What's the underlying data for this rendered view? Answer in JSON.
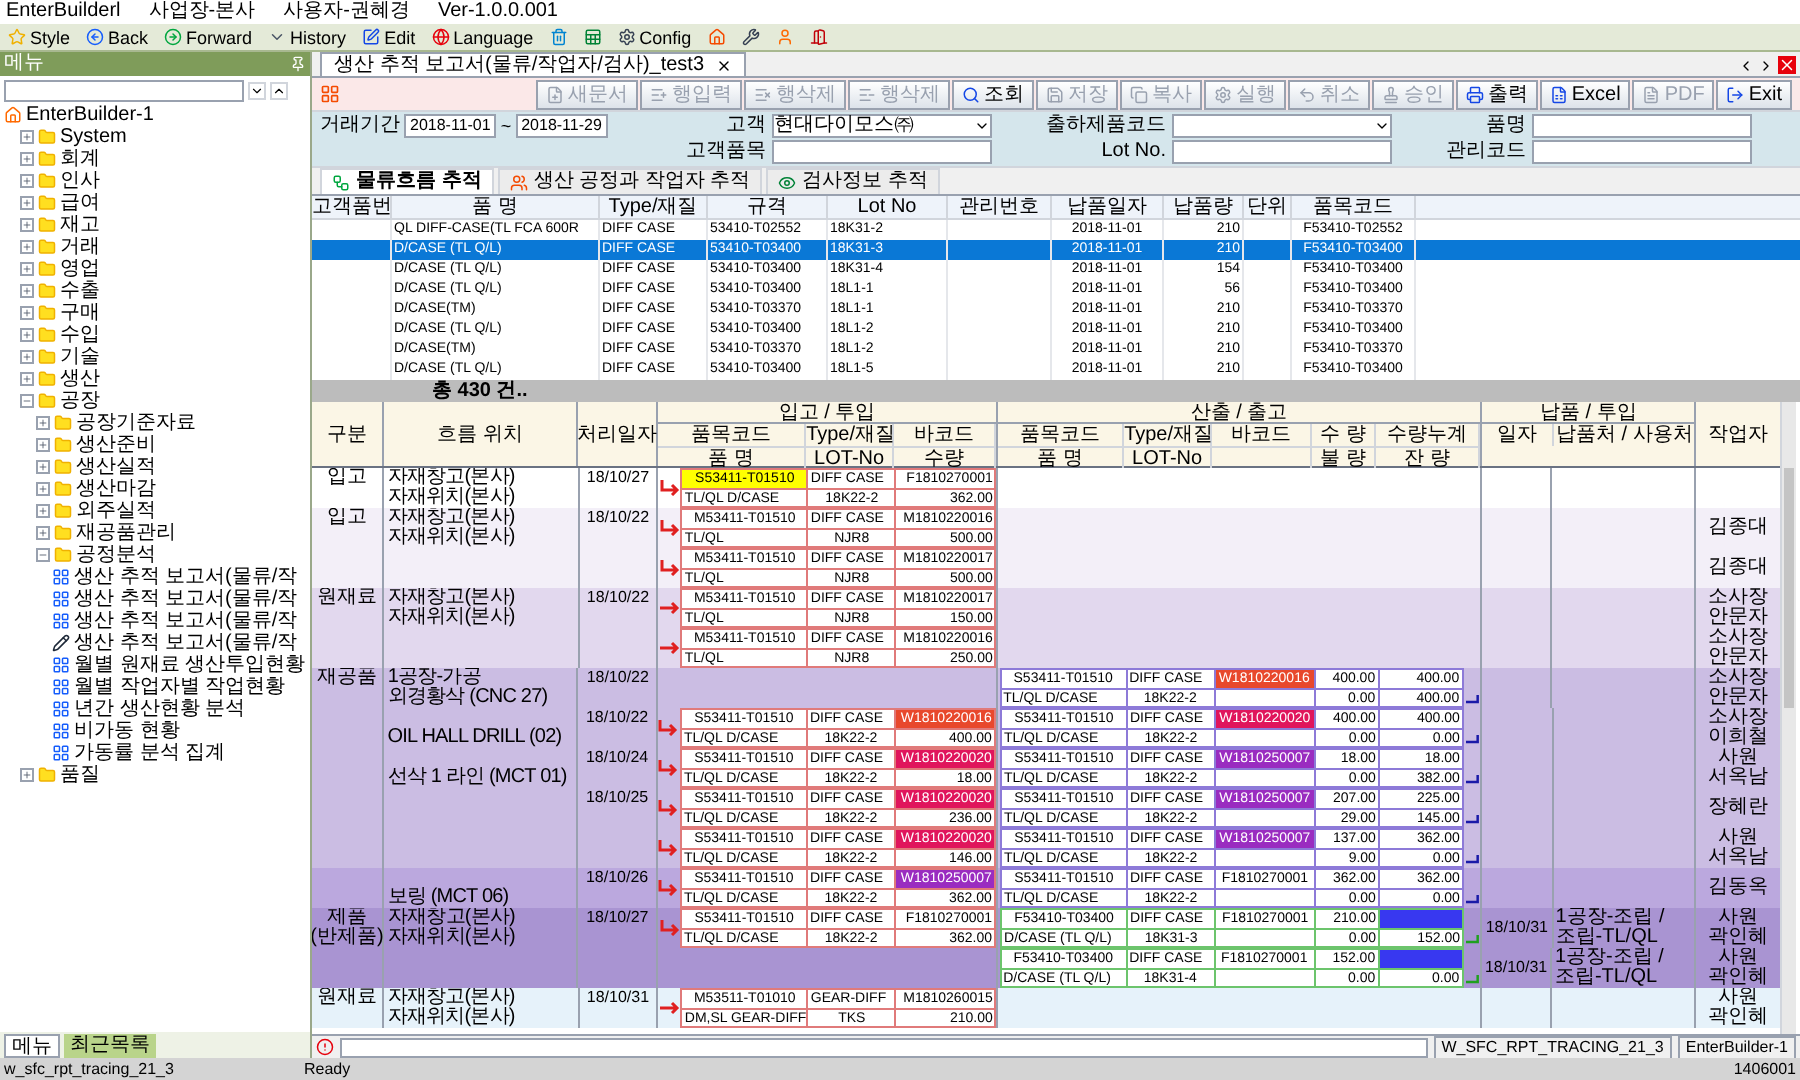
{
  "app_title": {
    "app": "EnterBuilderl",
    "site": "사업장-본사",
    "user": "사용자-권혜경",
    "version": "Ver-1.0.0.001"
  },
  "toolbar": [
    {
      "kind": "star",
      "label": "Style"
    },
    {
      "kind": "back",
      "label": "Back"
    },
    {
      "kind": "forward",
      "label": "Forward"
    },
    {
      "kind": "history",
      "label": "History"
    },
    {
      "kind": "edit",
      "label": "Edit"
    },
    {
      "kind": "language",
      "label": "Language"
    },
    {
      "kind": "bin"
    },
    {
      "kind": "sheet"
    },
    {
      "kind": "config",
      "label": "Config"
    },
    {
      "kind": "home"
    },
    {
      "kind": "tools"
    },
    {
      "kind": "user"
    },
    {
      "kind": "exit"
    }
  ],
  "sidebar": {
    "title": "메뉴",
    "tree": [
      {
        "label": "EnterBuilder-1",
        "kind": "root",
        "children": [
          {
            "label": "System",
            "kind": "folder",
            "expanded": false
          },
          {
            "label": "회계",
            "kind": "folder",
            "expanded": false
          },
          {
            "label": "인사",
            "kind": "folder",
            "expanded": false
          },
          {
            "label": "급여",
            "kind": "folder",
            "expanded": false
          },
          {
            "label": "재고",
            "kind": "folder",
            "expanded": false
          },
          {
            "label": "거래",
            "kind": "folder",
            "expanded": false
          },
          {
            "label": "영업",
            "kind": "folder",
            "expanded": false
          },
          {
            "label": "수출",
            "kind": "folder",
            "expanded": false
          },
          {
            "label": "구매",
            "kind": "folder",
            "expanded": false
          },
          {
            "label": "수입",
            "kind": "folder",
            "expanded": false
          },
          {
            "label": "기술",
            "kind": "folder",
            "expanded": false
          },
          {
            "label": "생산",
            "kind": "folder",
            "expanded": false
          },
          {
            "label": "공장",
            "kind": "folder",
            "expanded": true,
            "children": [
              {
                "label": "공장기준자료",
                "kind": "folder",
                "expanded": false
              },
              {
                "label": "생산준비",
                "kind": "folder",
                "expanded": false
              },
              {
                "label": "생산실적",
                "kind": "folder",
                "expanded": false
              },
              {
                "label": "생산마감",
                "kind": "folder",
                "expanded": false
              },
              {
                "label": "외주실적",
                "kind": "folder",
                "expanded": false
              },
              {
                "label": "재공품관리",
                "kind": "folder",
                "expanded": false
              },
              {
                "label": "공정분석",
                "kind": "folder",
                "expanded": true,
                "children": [
                  {
                    "label": "생산 추적 보고서(물류/작",
                    "kind": "program"
                  },
                  {
                    "label": "생산 추적 보고서(물류/작",
                    "kind": "program"
                  },
                  {
                    "label": "생산 추적 보고서(물류/작",
                    "kind": "program"
                  },
                  {
                    "label": "생산 추적 보고서(물류/작",
                    "kind": "active_program"
                  },
                  {
                    "label": "월별 원재료 생산투입현황",
                    "kind": "program"
                  },
                  {
                    "label": "월별 작업자별 작업현황",
                    "kind": "program"
                  },
                  {
                    "label": "년간 생산현황 분석",
                    "kind": "program"
                  },
                  {
                    "label": "비가동 현황",
                    "kind": "program"
                  },
                  {
                    "label": "가동률 분석 집계",
                    "kind": "program"
                  }
                ]
              }
            ]
          },
          {
            "label": "품질",
            "kind": "folder",
            "expanded": false
          }
        ]
      }
    ],
    "bottom_tabs": [
      {
        "label": "메뉴",
        "selected": true
      },
      {
        "label": "최근목록",
        "selected": false
      }
    ]
  },
  "doc_tab": {
    "title": "생산 추적 보고서(물류/작업자/검사)_test3",
    "selected": true
  },
  "actions": [
    {
      "kind": "new",
      "label": "새문서",
      "disabled": true
    },
    {
      "kind": "row_add",
      "label": "행입력",
      "disabled": true
    },
    {
      "kind": "row_del",
      "label": "행삭제",
      "disabled": true
    },
    {
      "kind": "row_del2",
      "label": "행삭제",
      "disabled": true
    },
    {
      "kind": "search",
      "label": "조회",
      "disabled": false
    },
    {
      "kind": "save",
      "label": "저장",
      "disabled": true
    },
    {
      "kind": "copy",
      "label": "복사",
      "disabled": true
    },
    {
      "kind": "run",
      "label": "실행",
      "disabled": true
    },
    {
      "kind": "cancel",
      "label": "취소",
      "disabled": true
    },
    {
      "kind": "approve",
      "label": "승인",
      "disabled": true
    },
    {
      "kind": "print",
      "label": "출력",
      "disabled": false
    },
    {
      "kind": "excel",
      "label": "Excel",
      "disabled": false
    },
    {
      "kind": "pdf",
      "label": "PDF",
      "disabled": true
    },
    {
      "kind": "exit",
      "label": "Exit",
      "disabled": false
    }
  ],
  "filters": {
    "period": {
      "label": "거래기간",
      "from": "2018-11-01",
      "separator": "~",
      "to": "2018-11-29"
    },
    "fields": [
      {
        "kind": "combo",
        "label": "고객",
        "value": "현대다이모스㈜"
      },
      {
        "kind": "combo",
        "label": "출하제품코드"
      },
      {
        "kind": "text",
        "label": "품명"
      },
      {
        "kind": "text",
        "label": "고객품목"
      },
      {
        "kind": "text",
        "label": "Lot No."
      },
      {
        "kind": "text",
        "label": "관리코드"
      }
    ]
  },
  "view_tabs": [
    {
      "kind": "flow",
      "label": "물류흐름 추적",
      "selected": true
    },
    {
      "kind": "worker",
      "label": "생산 공정과 작업자 추적",
      "selected": false
    },
    {
      "kind": "inspect",
      "label": "검사정보 추적",
      "selected": false
    }
  ],
  "summary_grid": {
    "columns": [
      "고객품번",
      "품 명",
      "Type/재질",
      "규격",
      "Lot No",
      "관리번호",
      "납품일자",
      "납품량",
      "단위",
      "품목코드"
    ],
    "rows": [
      {
        "name": "QL DIFF-CASE(TL FCA 600R",
        "type": "DIFF CASE",
        "spec": "53410-T02552",
        "lot": "18K31-2",
        "date": "2018-11-01",
        "qty": "210",
        "code": "F53410-T02552",
        "selected": false
      },
      {
        "name": "D/CASE (TL Q/L)",
        "type": "DIFF CASE",
        "spec": "53410-T03400",
        "lot": "18K31-3",
        "date": "2018-11-01",
        "qty": "210",
        "code": "F53410-T03400",
        "selected": true
      },
      {
        "name": "D/CASE (TL Q/L)",
        "type": "DIFF CASE",
        "spec": "53410-T03400",
        "lot": "18K31-4",
        "date": "2018-11-01",
        "qty": "154",
        "code": "F53410-T03400",
        "selected": false
      },
      {
        "name": "D/CASE (TL Q/L)",
        "type": "DIFF CASE",
        "spec": "53410-T03400",
        "lot": "18L1-1",
        "date": "2018-11-01",
        "qty": "56",
        "code": "F53410-T03400",
        "selected": false
      },
      {
        "name": "D/CASE(TM)",
        "type": "DIFF CASE",
        "spec": "53410-T03370",
        "lot": "18L1-1",
        "date": "2018-11-01",
        "qty": "210",
        "code": "F53410-T03370",
        "selected": false
      },
      {
        "name": "D/CASE (TL Q/L)",
        "type": "DIFF CASE",
        "spec": "53410-T03400",
        "lot": "18L1-2",
        "date": "2018-11-01",
        "qty": "210",
        "code": "F53410-T03400",
        "selected": false
      },
      {
        "name": "D/CASE(TM)",
        "type": "DIFF CASE",
        "spec": "53410-T03370",
        "lot": "18L1-2",
        "date": "2018-11-01",
        "qty": "210",
        "code": "F53410-T03370",
        "selected": false
      },
      {
        "name": "D/CASE (TL Q/L)",
        "type": "DIFF CASE",
        "spec": "53410-T03400",
        "lot": "18L1-5",
        "date": "2018-11-01",
        "qty": "210",
        "code": "F53410-T03400",
        "selected": false
      }
    ],
    "footer": "총 430 건.."
  },
  "trace_grid": {
    "headers": {
      "category": "구분",
      "location": "흐름 위치",
      "date": "처리일자",
      "in_group": "입고 / 투입",
      "out_group": "산출 / 출고",
      "delivery_group": "납품 / 투입",
      "worker": "작업자",
      "delivery_date": "일자",
      "delivery_place": "납품처 / 사용처",
      "in_columns": [
        [
          "품목코드",
          "품 명"
        ],
        [
          "Type/재질",
          "LOT-No"
        ],
        [
          "바코드",
          "수량"
        ]
      ],
      "out_columns": [
        [
          "품목코드",
          "품 명"
        ],
        [
          "Type/재질",
          "LOT-No"
        ],
        [
          "바코드"
        ],
        [
          "수 량",
          "불 량"
        ],
        [
          "수량누계",
          "잔 량"
        ]
      ]
    },
    "rows": [
      {
        "color": "#ffffff",
        "category": "입고",
        "location": [
          "자재창고(본사)",
          "자재위치(본사)"
        ],
        "date": "18/10/27",
        "in": {
          "kind": "return",
          "code": "S53411-T01510",
          "highlight": true,
          "type": "DIFF CASE",
          "barcode": {
            "text": "F1810270001"
          },
          "name": "TL/QL D/CASE",
          "lot": "18K22-2",
          "qty": "362.00"
        }
      },
      {
        "color": "#f3eff8",
        "category": "입고",
        "location": [
          "자재창고(본사)",
          "자재위치(본사)"
        ],
        "date": "18/10/22",
        "in": {
          "kind": "return",
          "code": "M53411-T01510",
          "highlight": false,
          "type": "DIFF CASE",
          "barcode": {
            "text": "M1810220016"
          },
          "name": "TL/QL",
          "lot": "NJR8",
          "qty": "500.00"
        },
        "worker": "김종대"
      },
      {
        "color": "#f3eff8",
        "in": {
          "kind": "return",
          "code": "M53411-T01510",
          "highlight": false,
          "type": "DIFF CASE",
          "barcode": {
            "text": "M1810220017"
          },
          "name": "TL/QL",
          "lot": "NJR8",
          "qty": "500.00"
        },
        "worker": "김종대"
      },
      {
        "color": "#e2d8ee",
        "category": "원재료",
        "location": [
          "자재창고(본사)",
          "자재위치(본사)"
        ],
        "date": "18/10/22",
        "in": {
          "kind": "straight",
          "code": "M53411-T01510",
          "highlight": false,
          "type": "DIFF CASE",
          "barcode": {
            "text": "M1810220017"
          },
          "name": "TL/QL",
          "lot": "NJR8",
          "qty": "150.00"
        },
        "worker": "소사장 안문자"
      },
      {
        "color": "#e2d8ee",
        "in": {
          "kind": "straight",
          "code": "M53411-T01510",
          "highlight": false,
          "type": "DIFF CASE",
          "barcode": {
            "text": "M1810220016"
          },
          "name": "TL/QL",
          "lot": "NJR8",
          "qty": "250.00"
        },
        "worker": "소사장 안문자"
      },
      {
        "color": "#cbbde3",
        "category": "재공품",
        "location": [
          "1공장-가공",
          "외경황삭 (CNC 27)"
        ],
        "date": "18/10/22",
        "out": {
          "kind": "wip",
          "code": "S53411-T01510",
          "type": "DIFF CASE",
          "barcode": {
            "text": "W1810220016",
            "color": "#e8482c"
          },
          "name": "TL/QL D/CASE",
          "lot": "18K22-2",
          "qty": "400.00",
          "defect": "0.00",
          "cum": "400.00",
          "remain": "400.00"
        },
        "worker": "소사장 안문자"
      },
      {
        "color": "#cbbde3",
        "location": [
          "OIL HALL DRILL (02)"
        ],
        "date": "18/10/22",
        "in": {
          "kind": "return",
          "code": "S53411-T01510",
          "highlight": false,
          "type": "DIFF CASE",
          "barcode": {
            "text": "W1810220016",
            "color": "#e8482c"
          },
          "name": "TL/QL D/CASE",
          "lot": "18K22-2",
          "qty": "400.00"
        },
        "out": {
          "kind": "wip",
          "code": "S53411-T01510",
          "type": "DIFF CASE",
          "barcode": {
            "text": "W1810220020",
            "color": "#e0155c"
          },
          "name": "TL/QL D/CASE",
          "lot": "18K22-2",
          "qty": "400.00",
          "defect": "0.00",
          "cum": "400.00",
          "remain": "0.00"
        },
        "worker": "소사장 이희철"
      },
      {
        "color": "#cbbde3",
        "location": [
          "선삭 1 라인 (MCT 01)"
        ],
        "date": "18/10/24",
        "in": {
          "kind": "return",
          "code": "S53411-T01510",
          "highlight": false,
          "type": "DIFF CASE",
          "barcode": {
            "text": "W1810220020",
            "color": "#e0155c"
          },
          "name": "TL/QL D/CASE",
          "lot": "18K22-2",
          "qty": "18.00"
        },
        "out": {
          "kind": "wip",
          "code": "S53411-T01510",
          "type": "DIFF CASE",
          "barcode": {
            "text": "W1810250007",
            "color": "#9a2cc0"
          },
          "name": "TL/QL D/CASE",
          "lot": "18K22-2",
          "qty": "18.00",
          "defect": "0.00",
          "cum": "18.00",
          "remain": "382.00"
        },
        "worker": "사원 서옥남"
      },
      {
        "color": "#cbbde3",
        "date": "18/10/25",
        "in": {
          "kind": "return",
          "code": "S53411-T01510",
          "highlight": false,
          "type": "DIFF CASE",
          "barcode": {
            "text": "W1810220020",
            "color": "#e0155c"
          },
          "name": "TL/QL D/CASE",
          "lot": "18K22-2",
          "qty": "236.00"
        },
        "out": {
          "kind": "wip",
          "code": "S53411-T01510",
          "type": "DIFF CASE",
          "barcode": {
            "text": "W1810250007",
            "color": "#9a2cc0"
          },
          "name": "TL/QL D/CASE",
          "lot": "18K22-2",
          "qty": "207.00",
          "defect": "29.00",
          "cum": "225.00",
          "remain": "145.00"
        },
        "worker": "장혜란"
      },
      {
        "color": "#cbbde3",
        "in": {
          "kind": "return",
          "code": "S53411-T01510",
          "highlight": false,
          "type": "DIFF CASE",
          "barcode": {
            "text": "W1810220020",
            "color": "#e0155c"
          },
          "name": "TL/QL D/CASE",
          "lot": "18K22-2",
          "qty": "146.00"
        },
        "out": {
          "kind": "wip",
          "code": "S53411-T01510",
          "type": "DIFF CASE",
          "barcode": {
            "text": "W1810250007",
            "color": "#9a2cc0"
          },
          "name": "TL/QL D/CASE",
          "lot": "18K22-2",
          "qty": "137.00",
          "defect": "9.00",
          "cum": "362.00",
          "remain": "0.00"
        },
        "worker": "사원 서옥남"
      },
      {
        "color": "#bba8de",
        "location": [
          "보링 (MCT 06)"
        ],
        "date": "18/10/26",
        "in": {
          "kind": "return",
          "code": "S53411-T01510",
          "highlight": false,
          "type": "DIFF CASE",
          "barcode": {
            "text": "W1810250007",
            "color": "#9a2cc0"
          },
          "name": "TL/QL D/CASE",
          "lot": "18K22-2",
          "qty": "362.00"
        },
        "out": {
          "kind": "wip",
          "code": "S53411-T01510",
          "type": "DIFF CASE",
          "barcode": {
            "text": "F1810270001"
          },
          "name": "TL/QL D/CASE",
          "lot": "18K22-2",
          "qty": "362.00",
          "defect": "0.00",
          "cum": "362.00",
          "remain": "0.00"
        },
        "worker": "김동옥"
      },
      {
        "color": "#a994d2",
        "category": "제품\n(반제품)",
        "location": [
          "자재창고(본사)",
          "자재위치(본사)"
        ],
        "date": "18/10/27",
        "in": {
          "kind": "return",
          "code": "S53411-T01510",
          "highlight": false,
          "type": "DIFF CASE",
          "barcode": {
            "text": "F1810270001"
          },
          "name": "TL/QL D/CASE",
          "lot": "18K22-2",
          "qty": "362.00"
        },
        "out": {
          "kind": "product",
          "code": "F53410-T03400",
          "type": "DIFF CASE",
          "barcode": {
            "text": "F1810270001"
          },
          "name": "D/CASE (TL Q/L)",
          "lot": "18K31-3",
          "qty": "210.00",
          "defect": "0.00",
          "cum_bar": true,
          "remain": "152.00"
        },
        "delivery": {
          "date": "18/10/31",
          "place": "1공장-조립 / 조립-TL/QL"
        },
        "worker": "사원 곽인혜"
      },
      {
        "color": "#a994d2",
        "out": {
          "kind": "product",
          "code": "F53410-T03400",
          "type": "DIFF CASE",
          "barcode": {
            "text": "F1810270001"
          },
          "name": "D/CASE (TL Q/L)",
          "lot": "18K31-4",
          "qty": "152.00",
          "defect": "0.00",
          "cum_bar": true,
          "remain": "0.00"
        },
        "delivery": {
          "date": "18/10/31",
          "place": "1공장-조립 / 조립-TL/QL"
        },
        "worker": "사원 곽인혜"
      },
      {
        "color": "#e6f2fa",
        "category": "원재료",
        "location": [
          "자재창고(본사)",
          "자재위치(본사)"
        ],
        "date": "18/10/31",
        "in": {
          "kind": "straight",
          "code": "M53511-T01010",
          "highlight": false,
          "type": "GEAR-DIFF",
          "barcode": {
            "text": "M1810260015"
          },
          "name": "DM,SL GEAR-DIFF",
          "lot": "TKS",
          "qty": "210.00"
        },
        "worker": "사원 곽인혜"
      }
    ]
  },
  "message_bar": {
    "program": "W_SFC_RPT_TRACING_21_3",
    "instance": "EnterBuilder-1"
  },
  "status_bar": {
    "window": "w_sfc_rpt_tracing_21_3",
    "state": "Ready",
    "code": "1406001"
  }
}
